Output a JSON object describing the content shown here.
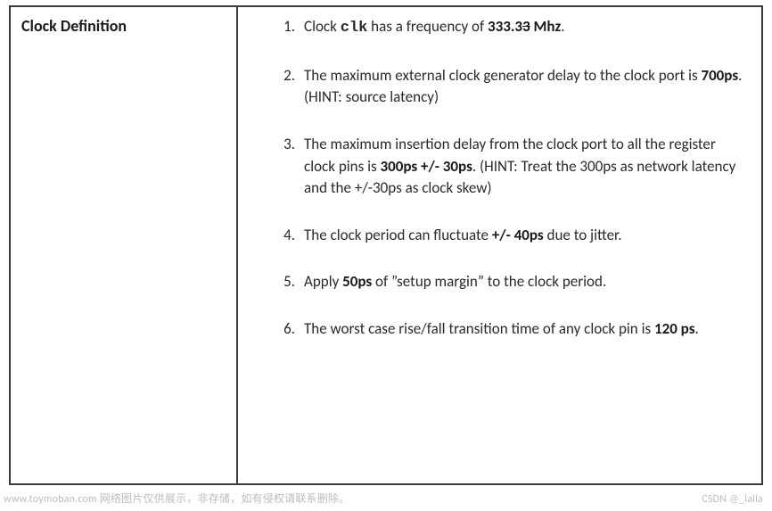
{
  "heading": "Clock Definition",
  "items": [
    {
      "pre": "Clock ",
      "code": "clk",
      "mid1": " has a frequency of ",
      "bold1": "333.3",
      "strike": "3",
      "bold2": " Mhz",
      "post": "."
    },
    {
      "pre": "The maximum external clock generator delay to the clock port is ",
      "bold1": "700ps",
      "post": ". (HINT: source latency)"
    },
    {
      "pre": "The maximum insertion delay from the clock port to all the register clock pins is ",
      "bold1": "300ps +/- 30ps",
      "post": ". (HINT: Treat the 300ps as network latency and the +/-30ps as clock skew)"
    },
    {
      "pre": "The clock period can fluctuate ",
      "bold1": "+/- 40ps",
      "post": " due to jitter."
    },
    {
      "pre": "Apply ",
      "bold1": "50ps",
      "post": " of ”setup margin” to the clock period."
    },
    {
      "pre": "The worst case rise/fall transition time of any clock pin is ",
      "bold1": "120 ps",
      "post": "."
    }
  ],
  "watermark_left": "www.toymoban.com 网络图片仅供展示，非存储，如有侵权请联系删除。",
  "watermark_right": "CSDN @_lalla"
}
